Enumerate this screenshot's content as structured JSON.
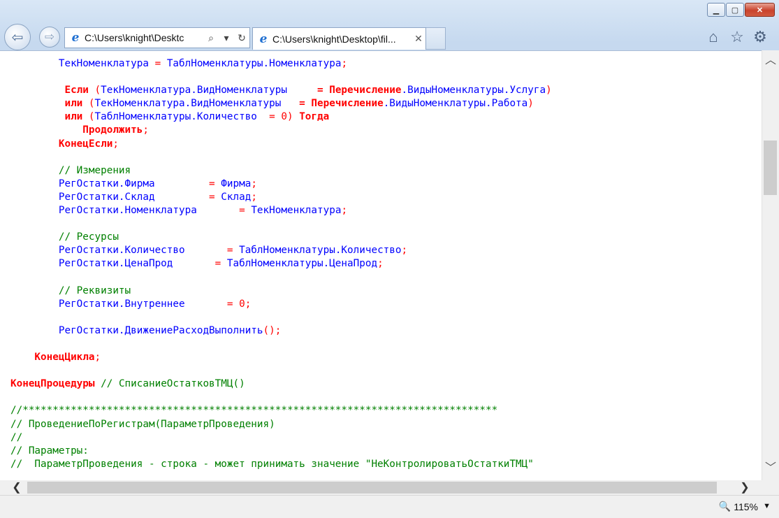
{
  "window": {
    "minimize_icon": "minimize-icon",
    "maximize_icon": "maximize-icon",
    "close_icon": "close-icon"
  },
  "nav": {
    "address": "C:\\Users\\knight\\Desktc",
    "tab_title": "C:\\Users\\knight\\Desktop\\fil...",
    "tab_close": "✕"
  },
  "code_lines": [
    [
      [
        "id",
        "        ТекНоменклатура "
      ],
      [
        "op",
        "= "
      ],
      [
        "id",
        "ТаблНоменклатуры.Номенклатура"
      ],
      [
        "op",
        ";"
      ]
    ],
    [],
    [
      [
        "k",
        "         Если "
      ],
      [
        "op",
        "("
      ],
      [
        "id",
        "ТекНоменклатура.ВидНоменклатуры    "
      ],
      [
        "k",
        " = Перечисление"
      ],
      [
        "id",
        ".ВидыНоменклатуры.Услуга"
      ],
      [
        "op",
        ")"
      ]
    ],
    [
      [
        "k",
        "         или "
      ],
      [
        "op",
        "("
      ],
      [
        "id",
        "ТекНоменклатура.ВидНоменклатуры  "
      ],
      [
        "k",
        " = Перечисление"
      ],
      [
        "id",
        ".ВидыНоменклатуры.Работа"
      ],
      [
        "op",
        ")"
      ]
    ],
    [
      [
        "k",
        "         или "
      ],
      [
        "op",
        "("
      ],
      [
        "id",
        "ТаблНоменклатуры.Количество  "
      ],
      [
        "op",
        "= 0) "
      ],
      [
        "k",
        "Тогда"
      ]
    ],
    [
      [
        "k",
        "            Продолжить"
      ],
      [
        "op",
        ";"
      ]
    ],
    [
      [
        "k",
        "        КонецЕсли"
      ],
      [
        "op",
        ";"
      ]
    ],
    [],
    [
      [
        "c",
        "        // Измерения"
      ]
    ],
    [
      [
        "id",
        "        РегОстатки.Фирма         "
      ],
      [
        "op",
        "= "
      ],
      [
        "id",
        "Фирма"
      ],
      [
        "op",
        ";"
      ]
    ],
    [
      [
        "id",
        "        РегОстатки.Склад         "
      ],
      [
        "op",
        "= "
      ],
      [
        "id",
        "Склад"
      ],
      [
        "op",
        ";"
      ]
    ],
    [
      [
        "id",
        "        РегОстатки.Номенклатура       "
      ],
      [
        "op",
        "= "
      ],
      [
        "id",
        "ТекНоменклатура"
      ],
      [
        "op",
        ";"
      ]
    ],
    [],
    [
      [
        "c",
        "        // Ресурсы"
      ]
    ],
    [
      [
        "id",
        "        РегОстатки.Количество       "
      ],
      [
        "op",
        "= "
      ],
      [
        "id",
        "ТаблНоменклатуры.Количество"
      ],
      [
        "op",
        ";"
      ]
    ],
    [
      [
        "id",
        "        РегОстатки.ЦенаПрод       "
      ],
      [
        "op",
        "= "
      ],
      [
        "id",
        "ТаблНоменклатуры.ЦенаПрод"
      ],
      [
        "op",
        ";"
      ]
    ],
    [],
    [
      [
        "c",
        "        // Реквизиты"
      ]
    ],
    [
      [
        "id",
        "        РегОстатки.Внутреннее       "
      ],
      [
        "op",
        "= 0;"
      ]
    ],
    [],
    [
      [
        "id",
        "        РегОстатки.ДвижениеРасходВыполнить"
      ],
      [
        "op",
        "();"
      ]
    ],
    [],
    [
      [
        "k",
        "    КонецЦикла"
      ],
      [
        "op",
        ";"
      ]
    ],
    [],
    [
      [
        "k",
        "КонецПроцедуры "
      ],
      [
        "c",
        "// СписаниеОстатковТМЦ()"
      ]
    ],
    [],
    [
      [
        "c",
        "//*******************************************************************************"
      ]
    ],
    [
      [
        "c",
        "// ПроведениеПоРегистрам(ПараметрПроведения)"
      ]
    ],
    [
      [
        "c",
        "//"
      ]
    ],
    [
      [
        "c",
        "// Параметры:"
      ]
    ],
    [
      [
        "c",
        "//  ПараметрПроведения - строка - может принимать значение \"НеКонтролироватьОстаткиТМЦ\""
      ]
    ]
  ],
  "status": {
    "zoom": "115%"
  }
}
